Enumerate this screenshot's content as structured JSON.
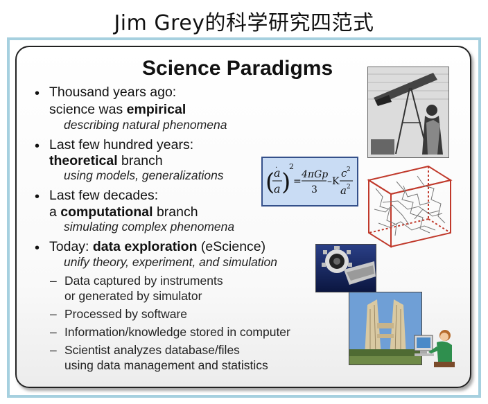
{
  "page": {
    "heading": "Jim Grey的科学研究四范式"
  },
  "slide": {
    "title": "Science Paradigms",
    "bullets": [
      {
        "line1": "Thousand years ago:",
        "line2_pre": "science was ",
        "line2_bold": "empirical",
        "line2_post": "",
        "sub": "describing natural phenomena"
      },
      {
        "line1": "Last few hundred years:",
        "line2_pre": "",
        "line2_bold": "theoretical",
        "line2_post": " branch",
        "sub": "using models, generalizations"
      },
      {
        "line1": "Last few decades:",
        "line2_pre": "a ",
        "line2_bold": "computational",
        "line2_post": " branch",
        "sub": "simulating complex phenomena"
      },
      {
        "line1_pre": "Today: ",
        "line1_bold": "data exploration",
        "line1_post": " (eScience)",
        "sub": "unify theory, experiment, and simulation"
      }
    ],
    "dash_items": [
      {
        "line1": "Data captured by instruments",
        "line2": "or generated by simulator"
      },
      {
        "line1": "Processed by software",
        "line2": ""
      },
      {
        "line1": "Information/knowledge stored in computer",
        "line2": ""
      },
      {
        "line1": "Scientist analyzes database/files",
        "line2": "using data management and statistics"
      }
    ]
  },
  "equation": {
    "a_dot": "a",
    "a": "a",
    "exp_2": "2",
    "equals": "=",
    "num": "4πGp",
    "den": "3",
    "minus_K": "–K",
    "c2": "c",
    "exp_c": "2",
    "a2": "a",
    "exp_a": "2"
  },
  "images": {
    "telescope": "astronomer-with-telescope-engraving",
    "cube": "simulation-cube",
    "satellite": "space-telescope-photo",
    "building": "lab-building-photo",
    "computer": "person-at-computer-clipart"
  }
}
